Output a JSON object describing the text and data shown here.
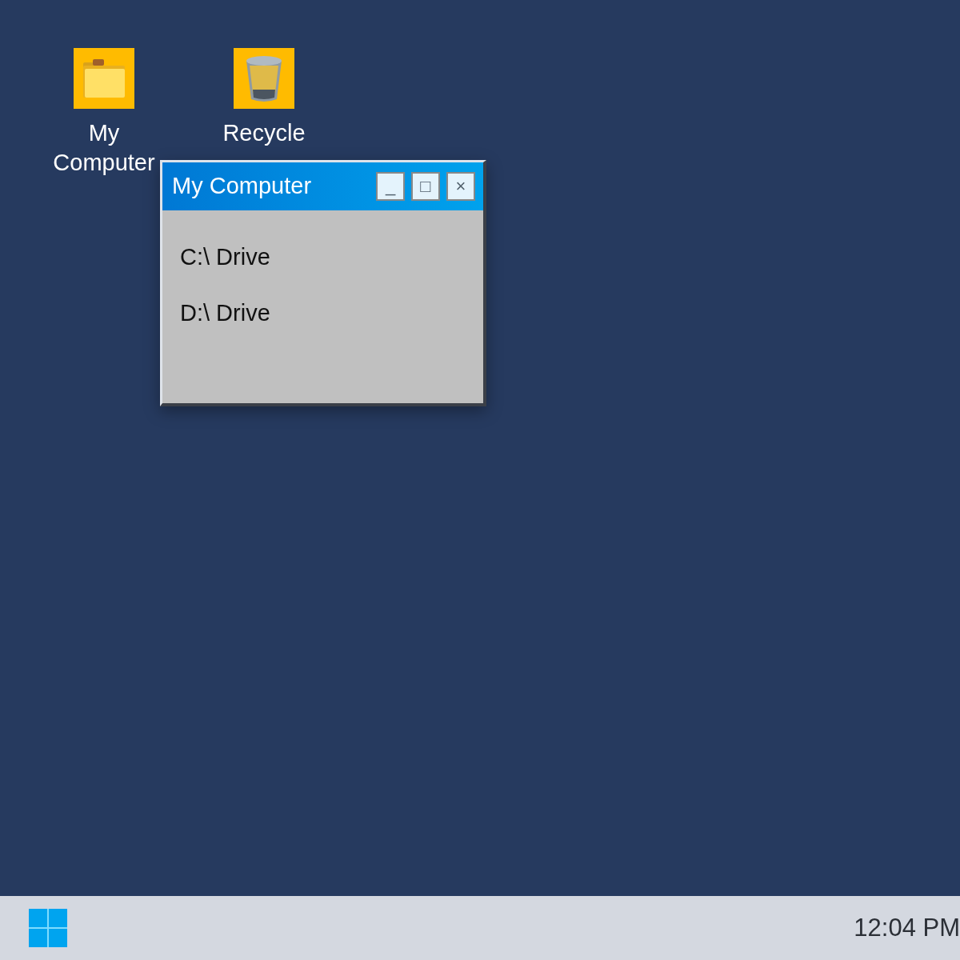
{
  "desktop_icons": [
    {
      "label": "My Computer",
      "kind": "folder"
    },
    {
      "label": "Recycle",
      "kind": "recycle"
    }
  ],
  "window": {
    "title": "My Computer",
    "controls": [
      "_",
      "□",
      "×"
    ],
    "items": [
      {
        "label": "C:\\ Drive"
      },
      {
        "label": "D:\\ Drive"
      }
    ]
  },
  "taskbar": {
    "clock": "12:04 PM"
  }
}
